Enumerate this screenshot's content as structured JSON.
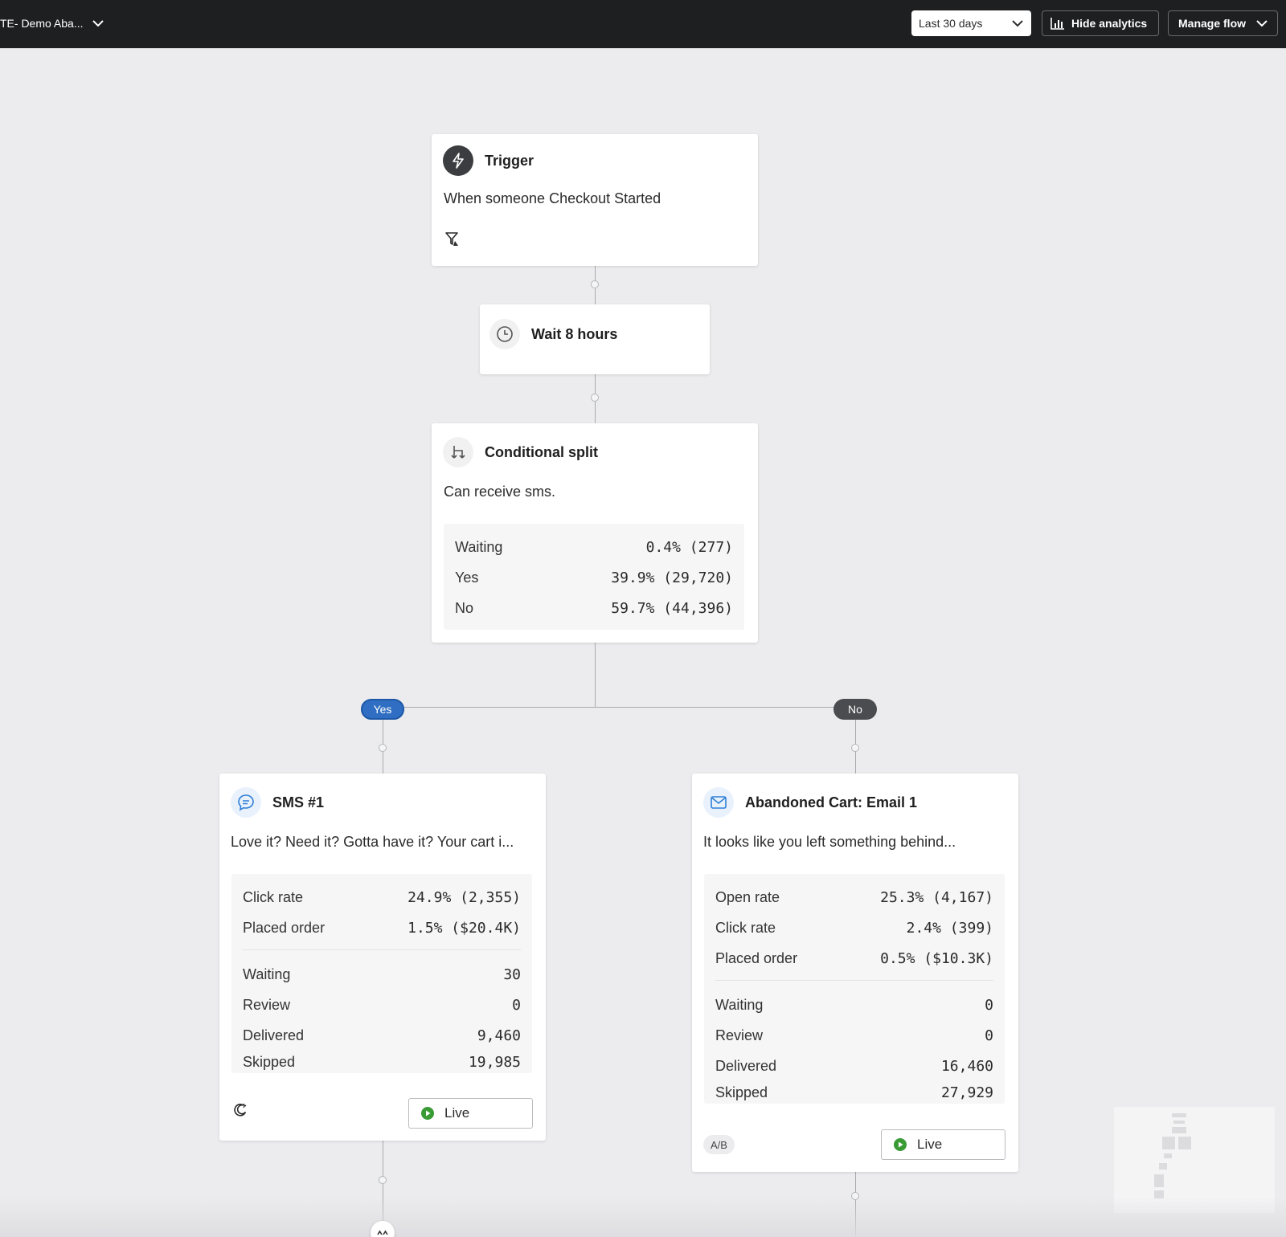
{
  "topbar": {
    "flow_name": "TE- Demo Aba...",
    "date_range": "Last 30 days",
    "hide_analytics": "Hide analytics",
    "manage_flow": "Manage flow"
  },
  "trigger": {
    "title": "Trigger",
    "description": "When someone Checkout Started",
    "icon": "lightning-icon"
  },
  "wait": {
    "title": "Wait 8 hours",
    "icon": "clock-icon"
  },
  "split": {
    "title": "Conditional split",
    "description": "Can receive sms.",
    "icon": "split-icon",
    "stats": [
      {
        "label": "Waiting",
        "value": "0.4% (277)"
      },
      {
        "label": "Yes",
        "value": "39.9% (29,720)"
      },
      {
        "label": "No",
        "value": "59.7% (44,396)"
      }
    ]
  },
  "branches": {
    "yes": "Yes",
    "no": "No"
  },
  "sms": {
    "title": "SMS #1",
    "description": "Love it? Need it? Gotta have it? Your cart i...",
    "icon": "chat-icon",
    "metrics": [
      {
        "label": "Click rate",
        "value": "24.9% (2,355)"
      },
      {
        "label": "Placed order",
        "value": "1.5% ($20.4K)"
      }
    ],
    "counts": [
      {
        "label": "Waiting",
        "value": "30"
      },
      {
        "label": "Review",
        "value": "0"
      },
      {
        "label": "Delivered",
        "value": "9,460"
      },
      {
        "label": "Skipped",
        "value": "19,985"
      }
    ],
    "status": "Live"
  },
  "email": {
    "title": "Abandoned Cart: Email 1",
    "description": "It looks like you left something behind...",
    "icon": "mail-icon",
    "metrics": [
      {
        "label": "Open rate",
        "value": "25.3% (4,167)"
      },
      {
        "label": "Click rate",
        "value": "2.4% (399)"
      },
      {
        "label": "Placed order",
        "value": "0.5% ($10.3K)"
      }
    ],
    "counts": [
      {
        "label": "Waiting",
        "value": "0"
      },
      {
        "label": "Review",
        "value": "0"
      },
      {
        "label": "Delivered",
        "value": "16,460"
      },
      {
        "label": "Skipped",
        "value": "27,929"
      }
    ],
    "badge": "A/B",
    "status": "Live"
  },
  "colors": {
    "topbar": "#1e1f21",
    "canvas": "#ececee",
    "yes_pill": "#2f6ec2",
    "no_pill": "#4a4c4f",
    "live_green": "#3a9b35",
    "sms_icon": "#2f7fd6",
    "email_icon": "#2f7fd6"
  }
}
